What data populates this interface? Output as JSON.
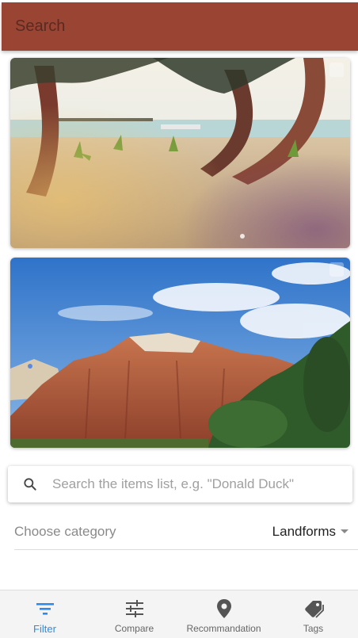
{
  "app_bar": {
    "title": "Search"
  },
  "cards": [
    {
      "name": "beach-palms-image"
    },
    {
      "name": "red-rock-mountain-image"
    }
  ],
  "search": {
    "placeholder": "Search the items list, e.g. \"Donald Duck\"",
    "value": ""
  },
  "category": {
    "label": "Choose category",
    "selected": "Landforms"
  },
  "bottom_nav": {
    "items": [
      {
        "label": "Filter",
        "icon": "filter-icon",
        "active": true
      },
      {
        "label": "Compare",
        "icon": "sliders-icon",
        "active": false
      },
      {
        "label": "Recommandation",
        "icon": "map-pin-icon",
        "active": false
      },
      {
        "label": "Tags",
        "icon": "tag-icon",
        "active": false
      }
    ]
  },
  "colors": {
    "app_bar": "#9a4433",
    "active_nav": "#2f8be6",
    "inactive_nav": "#666666"
  }
}
